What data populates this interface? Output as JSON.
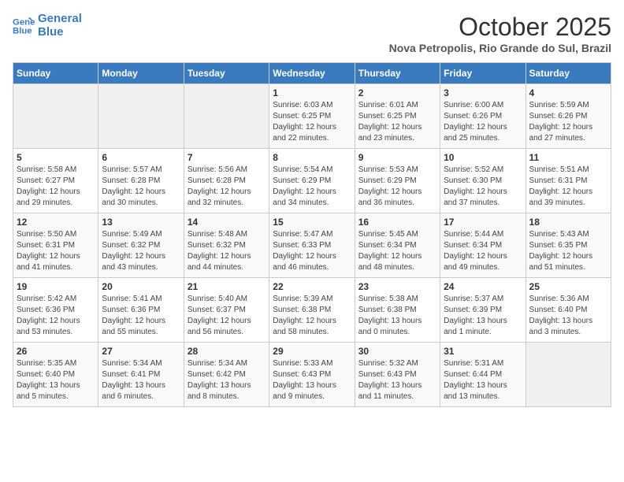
{
  "header": {
    "logo_line1": "General",
    "logo_line2": "Blue",
    "month_title": "October 2025",
    "subtitle": "Nova Petropolis, Rio Grande do Sul, Brazil"
  },
  "days_of_week": [
    "Sunday",
    "Monday",
    "Tuesday",
    "Wednesday",
    "Thursday",
    "Friday",
    "Saturday"
  ],
  "weeks": [
    [
      {
        "day": "",
        "info": ""
      },
      {
        "day": "",
        "info": ""
      },
      {
        "day": "",
        "info": ""
      },
      {
        "day": "1",
        "info": "Sunrise: 6:03 AM\nSunset: 6:25 PM\nDaylight: 12 hours\nand 22 minutes."
      },
      {
        "day": "2",
        "info": "Sunrise: 6:01 AM\nSunset: 6:25 PM\nDaylight: 12 hours\nand 23 minutes."
      },
      {
        "day": "3",
        "info": "Sunrise: 6:00 AM\nSunset: 6:26 PM\nDaylight: 12 hours\nand 25 minutes."
      },
      {
        "day": "4",
        "info": "Sunrise: 5:59 AM\nSunset: 6:26 PM\nDaylight: 12 hours\nand 27 minutes."
      }
    ],
    [
      {
        "day": "5",
        "info": "Sunrise: 5:58 AM\nSunset: 6:27 PM\nDaylight: 12 hours\nand 29 minutes."
      },
      {
        "day": "6",
        "info": "Sunrise: 5:57 AM\nSunset: 6:28 PM\nDaylight: 12 hours\nand 30 minutes."
      },
      {
        "day": "7",
        "info": "Sunrise: 5:56 AM\nSunset: 6:28 PM\nDaylight: 12 hours\nand 32 minutes."
      },
      {
        "day": "8",
        "info": "Sunrise: 5:54 AM\nSunset: 6:29 PM\nDaylight: 12 hours\nand 34 minutes."
      },
      {
        "day": "9",
        "info": "Sunrise: 5:53 AM\nSunset: 6:29 PM\nDaylight: 12 hours\nand 36 minutes."
      },
      {
        "day": "10",
        "info": "Sunrise: 5:52 AM\nSunset: 6:30 PM\nDaylight: 12 hours\nand 37 minutes."
      },
      {
        "day": "11",
        "info": "Sunrise: 5:51 AM\nSunset: 6:31 PM\nDaylight: 12 hours\nand 39 minutes."
      }
    ],
    [
      {
        "day": "12",
        "info": "Sunrise: 5:50 AM\nSunset: 6:31 PM\nDaylight: 12 hours\nand 41 minutes."
      },
      {
        "day": "13",
        "info": "Sunrise: 5:49 AM\nSunset: 6:32 PM\nDaylight: 12 hours\nand 43 minutes."
      },
      {
        "day": "14",
        "info": "Sunrise: 5:48 AM\nSunset: 6:32 PM\nDaylight: 12 hours\nand 44 minutes."
      },
      {
        "day": "15",
        "info": "Sunrise: 5:47 AM\nSunset: 6:33 PM\nDaylight: 12 hours\nand 46 minutes."
      },
      {
        "day": "16",
        "info": "Sunrise: 5:45 AM\nSunset: 6:34 PM\nDaylight: 12 hours\nand 48 minutes."
      },
      {
        "day": "17",
        "info": "Sunrise: 5:44 AM\nSunset: 6:34 PM\nDaylight: 12 hours\nand 49 minutes."
      },
      {
        "day": "18",
        "info": "Sunrise: 5:43 AM\nSunset: 6:35 PM\nDaylight: 12 hours\nand 51 minutes."
      }
    ],
    [
      {
        "day": "19",
        "info": "Sunrise: 5:42 AM\nSunset: 6:36 PM\nDaylight: 12 hours\nand 53 minutes."
      },
      {
        "day": "20",
        "info": "Sunrise: 5:41 AM\nSunset: 6:36 PM\nDaylight: 12 hours\nand 55 minutes."
      },
      {
        "day": "21",
        "info": "Sunrise: 5:40 AM\nSunset: 6:37 PM\nDaylight: 12 hours\nand 56 minutes."
      },
      {
        "day": "22",
        "info": "Sunrise: 5:39 AM\nSunset: 6:38 PM\nDaylight: 12 hours\nand 58 minutes."
      },
      {
        "day": "23",
        "info": "Sunrise: 5:38 AM\nSunset: 6:38 PM\nDaylight: 13 hours\nand 0 minutes."
      },
      {
        "day": "24",
        "info": "Sunrise: 5:37 AM\nSunset: 6:39 PM\nDaylight: 13 hours\nand 1 minute."
      },
      {
        "day": "25",
        "info": "Sunrise: 5:36 AM\nSunset: 6:40 PM\nDaylight: 13 hours\nand 3 minutes."
      }
    ],
    [
      {
        "day": "26",
        "info": "Sunrise: 5:35 AM\nSunset: 6:40 PM\nDaylight: 13 hours\nand 5 minutes."
      },
      {
        "day": "27",
        "info": "Sunrise: 5:34 AM\nSunset: 6:41 PM\nDaylight: 13 hours\nand 6 minutes."
      },
      {
        "day": "28",
        "info": "Sunrise: 5:34 AM\nSunset: 6:42 PM\nDaylight: 13 hours\nand 8 minutes."
      },
      {
        "day": "29",
        "info": "Sunrise: 5:33 AM\nSunset: 6:43 PM\nDaylight: 13 hours\nand 9 minutes."
      },
      {
        "day": "30",
        "info": "Sunrise: 5:32 AM\nSunset: 6:43 PM\nDaylight: 13 hours\nand 11 minutes."
      },
      {
        "day": "31",
        "info": "Sunrise: 5:31 AM\nSunset: 6:44 PM\nDaylight: 13 hours\nand 13 minutes."
      },
      {
        "day": "",
        "info": ""
      }
    ]
  ]
}
